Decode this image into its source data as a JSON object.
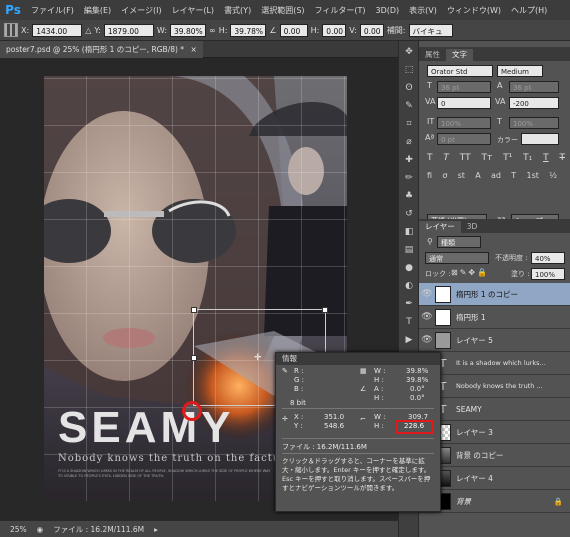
{
  "app": {
    "logo": "Ps"
  },
  "menu": [
    "ファイル(F)",
    "編集(E)",
    "イメージ(I)",
    "レイヤー(L)",
    "書式(Y)",
    "選択範囲(S)",
    "フィルター(T)",
    "3D(D)",
    "表示(V)",
    "ウィンドウ(W)",
    "ヘルプ(H)"
  ],
  "options": {
    "x_label": "X:",
    "x_value": "1434.00 px",
    "y_label": "Y:",
    "y_value": "1879.00 px",
    "w_label": "W:",
    "w_value": "39.80%",
    "h_label": "H:",
    "h_value": "39.78%",
    "angle_value": "0.00",
    "hskew_label": "H:",
    "hskew_value": "0.00",
    "vskew_label": "V:",
    "vskew_value": "0.00",
    "interp_label": "補間:",
    "interp_value": "バイキュー"
  },
  "document": {
    "tab_title": "poster7.psd @ 25% (楕円形 1 のコピー, RGB/8) *",
    "close_glyph": "×"
  },
  "poster": {
    "title": "SEAMY",
    "tagline": "Nobody knows the truth on the factual",
    "body": "IT IS A SHADOW WHICH LURKS IN THE REALM OF ALL PEOPLE, SHADOW WHICH LURKS THE SIDE OF PEOPLE WHERE WAY TO VISIBLE TO PEOPLE'S EYES. HIDDEN SIDE OF THE TRUTH."
  },
  "status": {
    "zoom": "25%",
    "file": "ファイル : 16.2M/111.6M"
  },
  "char_panel": {
    "tabs": [
      "属性",
      "文字"
    ],
    "font": "Orator Std",
    "style": "Medium",
    "size": "36 pt",
    "leading": "36 pt",
    "kerning": "0",
    "tracking": "-200",
    "vscale": "100%",
    "hscale": "100%",
    "baseline": "0 pt",
    "color_label": "カラー :",
    "lang": "英語 (米国)",
    "aa": "シャープ"
  },
  "layers_panel": {
    "tabs": [
      "レイヤー",
      "3D"
    ],
    "filter": "種類",
    "blend": "通常",
    "opacity_label": "不透明度 :",
    "opacity": "40%",
    "lock_label": "ロック :",
    "fill_label": "塗り :",
    "fill": "100%",
    "layers": [
      {
        "name": "楕円形 1 のコピー",
        "selected": true,
        "kind": "shape"
      },
      {
        "name": "楕円形 1",
        "selected": false,
        "kind": "shape"
      },
      {
        "name": "レイヤー 5",
        "selected": false,
        "kind": "gray"
      },
      {
        "name": "It is a shadow which lurks...",
        "selected": false,
        "kind": "text"
      },
      {
        "name": "Nobody knows the truth ...",
        "selected": false,
        "kind": "text"
      },
      {
        "name": "SEAMY",
        "selected": false,
        "kind": "text"
      },
      {
        "name": "レイヤー 3",
        "selected": false,
        "kind": "checker"
      },
      {
        "name": "背景 のコピー",
        "selected": false,
        "kind": "photo"
      },
      {
        "name": "レイヤー 4",
        "selected": false,
        "kind": "dark"
      },
      {
        "name": "背景",
        "selected": false,
        "kind": "black"
      }
    ]
  },
  "info_panel": {
    "title": "情報",
    "r_label": "R :",
    "g_label": "G :",
    "b_label": "B :",
    "bit_mode": "8 bit",
    "w_label": "W :",
    "w_value": "39.8%",
    "h_label": "H :",
    "h_value": "39.8%",
    "angle_label": "A :",
    "angle_value": "0.0°",
    "hskew_label": "H :",
    "hskew_value": "0.0°",
    "x_label": "X :",
    "x_value": "351.0",
    "y_label": "Y :",
    "y_value": "548.6",
    "w2_label": "W :",
    "w2_value": "309.7",
    "h2_label": "H :",
    "h2_value": "228.6",
    "file": "ファイル : 16.2M/111.6M",
    "help": "クリック＆ドラッグすると、コーナーを基準に拡大・縮小します。Enter キーを押すと確定します。Esc キーを押すと取り消します。スペースバーを押すとナビゲーションツールが開きます。"
  },
  "colors": {
    "highlight": "#e01a1a",
    "selected_layer": "#8fa6c4",
    "ps_blue": "#31a8ff"
  }
}
